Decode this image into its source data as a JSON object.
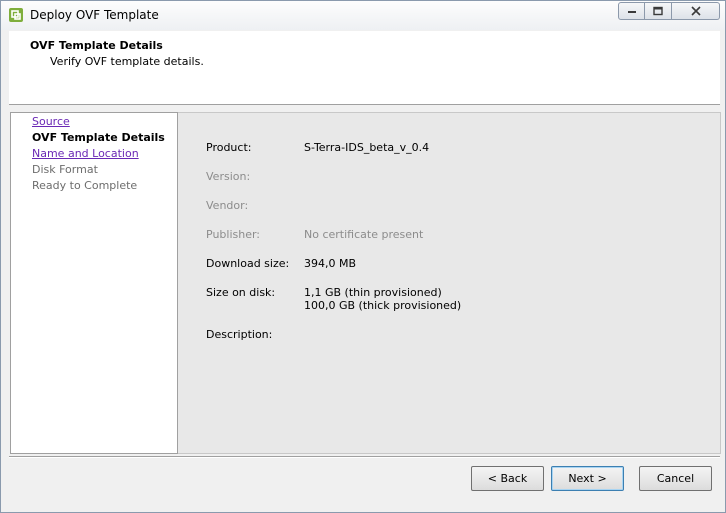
{
  "window": {
    "title": "Deploy OVF Template",
    "icon": "vsphere-ovf-icon"
  },
  "header": {
    "title": "OVF Template Details",
    "subtitle": "Verify OVF template details."
  },
  "nav": {
    "items": [
      {
        "label": "Source",
        "state": "link"
      },
      {
        "label": "OVF Template Details",
        "state": "current"
      },
      {
        "label": "Name and Location",
        "state": "link"
      },
      {
        "label": "Disk Format",
        "state": "disabled"
      },
      {
        "label": "Ready to Complete",
        "state": "disabled"
      }
    ]
  },
  "details": {
    "product_label": "Product:",
    "product_value": "S-Terra-IDS_beta_v_0.4",
    "version_label": "Version:",
    "version_value": "",
    "vendor_label": "Vendor:",
    "vendor_value": "",
    "publisher_label": "Publisher:",
    "publisher_value": "No certificate present",
    "download_label": "Download size:",
    "download_value": "394,0 MB",
    "disk_label": "Size on disk:",
    "disk_value_thin": "1,1 GB (thin provisioned)",
    "disk_value_thick": "100,0 GB (thick provisioned)",
    "description_label": "Description:",
    "description_value": ""
  },
  "footer": {
    "back_label": "< Back",
    "next_label": "Next >",
    "cancel_label": "Cancel"
  },
  "colors": {
    "link": "#6a28b5",
    "disabled_text": "#8c8c8c",
    "content_bg": "#e8e8e8"
  }
}
